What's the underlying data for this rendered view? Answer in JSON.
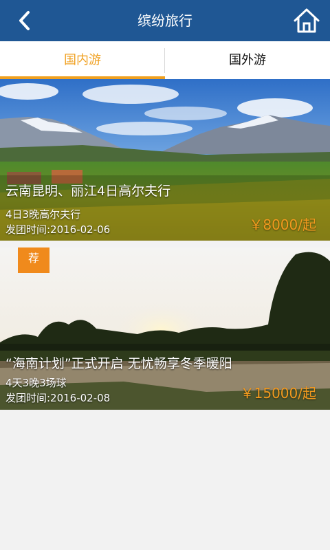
{
  "header": {
    "title": "缤纷旅行",
    "back_icon": "chevron-left-icon",
    "home_icon": "home-icon"
  },
  "tabs": [
    {
      "label": "国内游",
      "active": true
    },
    {
      "label": "国外游",
      "active": false
    }
  ],
  "colors": {
    "header_bg": "#1f5794",
    "accent": "#f0a020",
    "price": "#f39a1e",
    "badge": "#f08a1c"
  },
  "tours": [
    {
      "title": "云南昆明、丽江4日高尔夫行",
      "subtitle": "4日3晚高尔夫行",
      "departure": "发团时间:2016-02-06",
      "price": "￥8000/起",
      "badge": ""
    },
    {
      "title": "“海南计划”正式开启 无忧畅享冬季暖阳",
      "subtitle": "4天3晚3场球",
      "departure": "发团时间:2016-02-08",
      "price": "￥15000/起",
      "badge": "荐"
    }
  ]
}
